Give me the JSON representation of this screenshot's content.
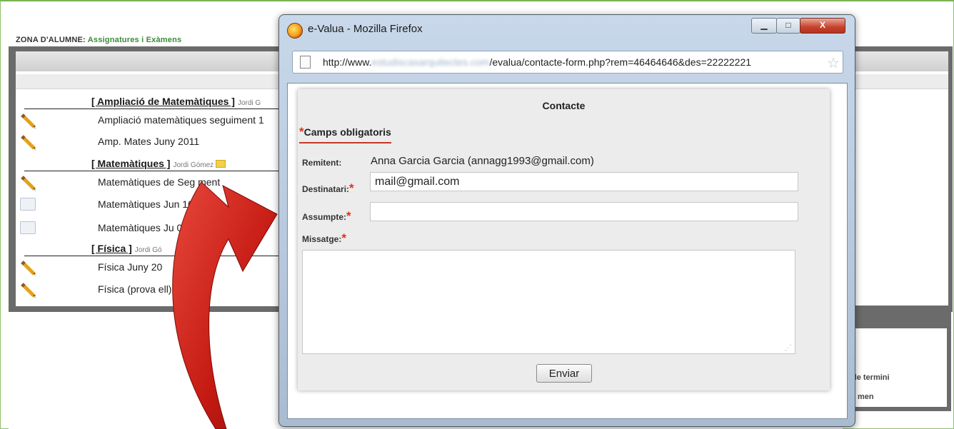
{
  "background_page": {
    "header_prefix": "ZONA D'ALUMNE:",
    "header_section": "Assignatures i Exàmens",
    "subjects": [
      {
        "title": "[ Ampliació de Matemàtiques ]",
        "teacher": "Jordi G",
        "exams": [
          "Ampliació matemàtiques seguiment 1",
          "Amp. Mates Juny 2011"
        ]
      },
      {
        "title": "[ Matemàtiques ]",
        "teacher": "Jordi Gómez",
        "exams": [
          "Matemàtiques de Seg   ment",
          "Matemàtiques Jun   10",
          "Matemàtiques Ju    011"
        ]
      },
      {
        "title": "[ Física ]",
        "teacher": "Jordi Gó",
        "exams": [
          "Física Juny 20",
          "Física (prova       ell)"
        ]
      }
    ],
    "side_text_1": "de termini",
    "side_text_2": "men"
  },
  "browser": {
    "window_title": "e-Valua - Mozilla Firefox",
    "url_prefix": "http://www.",
    "url_blurred": "estudiscasarquitectes.com",
    "url_suffix": "/evalua/contacte-form.php?rem=46464646&des=22222221",
    "close_glyph": "X"
  },
  "form": {
    "title": "Contacte",
    "required_star": "*",
    "required_note": "Camps obligatoris",
    "sender_label": "Remitent:",
    "sender_value": "Anna Garcia Garcia (annagg1993@gmail.com)",
    "recipient_label": "Destinatari:",
    "recipient_value": "mail@gmail.com",
    "subject_label": "Assumpte:",
    "subject_value": "",
    "message_label": "Missatge:",
    "message_value": "",
    "send_label": "Enviar"
  },
  "colors": {
    "required_star": "#e0301e",
    "arrow_red": "#c41a12",
    "header_green": "#3a8a3a"
  }
}
